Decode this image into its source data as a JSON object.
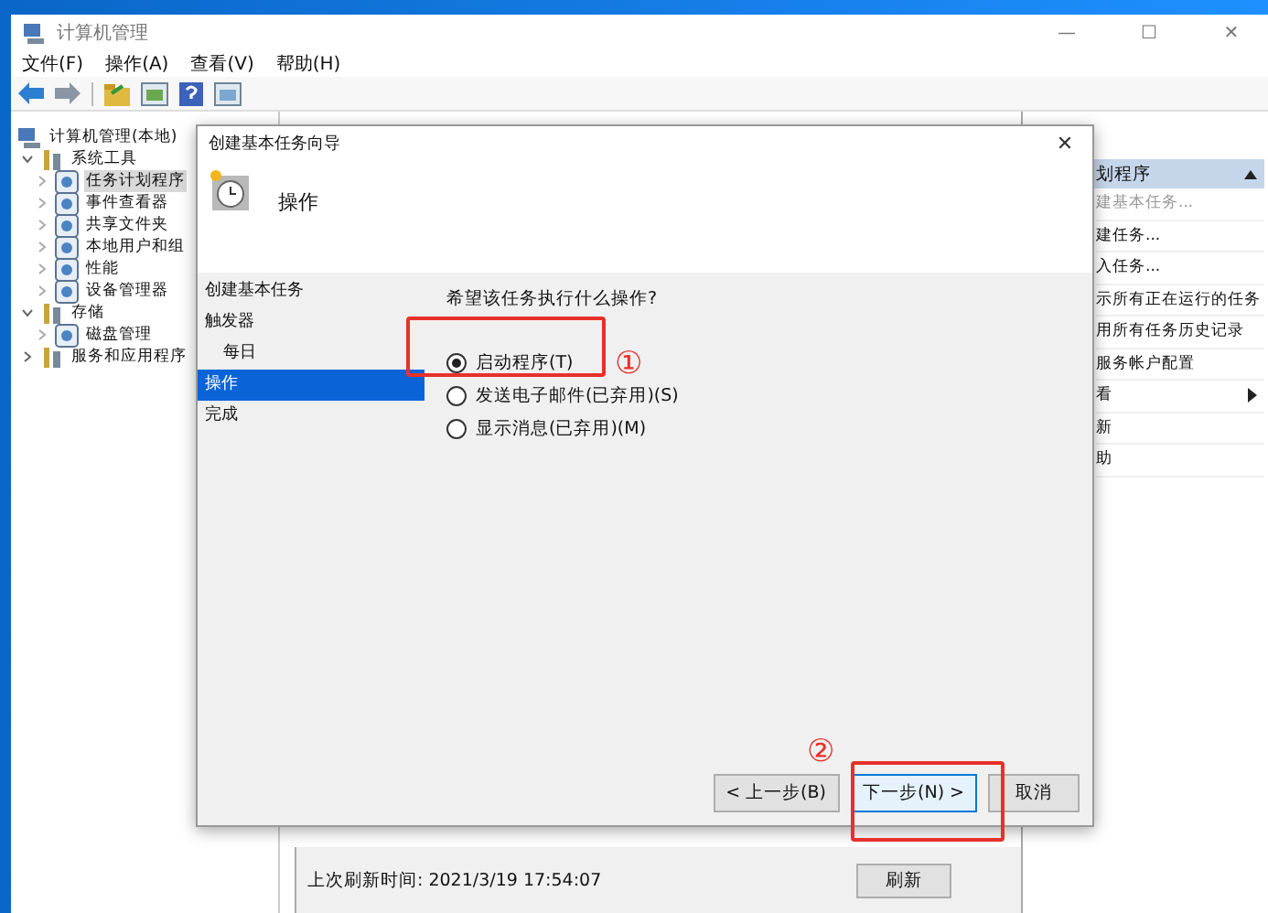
{
  "window": {
    "title": "计算机管理",
    "controls": [
      "—",
      "☐",
      "✕"
    ]
  },
  "menu": [
    "文件(F)",
    "操作(A)",
    "查看(V)",
    "帮助(H)"
  ],
  "tree": [
    {
      "label": "计算机管理(本地)",
      "selected": false,
      "children": [
        {
          "label": "系统工具",
          "expanded": true,
          "selected": false,
          "children": [
            {
              "label": "任务计划程序",
              "selected": true
            },
            {
              "label": "事件查看器",
              "selected": false
            },
            {
              "label": "共享文件夹",
              "selected": false
            },
            {
              "label": "本地用户和组",
              "selected": false
            },
            {
              "label": "性能",
              "selected": false
            },
            {
              "label": "设备管理器",
              "selected": false
            }
          ]
        },
        {
          "label": "存储",
          "expanded": true,
          "selected": false,
          "children": [
            {
              "label": "磁盘管理",
              "selected": false
            }
          ]
        },
        {
          "label": "服务和应用程序",
          "expanded": false,
          "selected": false
        }
      ]
    }
  ],
  "center": {
    "last_refresh": "上次刷新时间: 2021/3/19 17:54:07",
    "refresh_button": "刷新"
  },
  "actions": {
    "header": "划程序",
    "items": [
      {
        "label": "建基本任务...",
        "disabled": true,
        "submenu": false
      },
      {
        "label": "建任务...",
        "disabled": false,
        "submenu": false
      },
      {
        "label": "入任务...",
        "disabled": false,
        "submenu": false
      },
      {
        "label": "示所有正在运行的任务",
        "disabled": false,
        "submenu": false
      },
      {
        "label": "用所有任务历史记录",
        "disabled": false,
        "submenu": false
      },
      {
        "label": "服务帐户配置",
        "disabled": false,
        "submenu": false
      },
      {
        "label": "看",
        "disabled": false,
        "submenu": true
      },
      {
        "label": "新",
        "disabled": false,
        "submenu": false
      },
      {
        "label": "助",
        "disabled": false,
        "submenu": false
      }
    ]
  },
  "dialog": {
    "title": "创建基本任务向导",
    "close": "✕",
    "heading": "操作",
    "steps": [
      {
        "label": "创建基本任务",
        "selected": false,
        "indent": false
      },
      {
        "label": "触发器",
        "selected": false,
        "indent": false
      },
      {
        "label": "每日",
        "selected": false,
        "indent": true
      },
      {
        "label": "操作",
        "selected": true,
        "indent": false
      },
      {
        "label": "完成",
        "selected": false,
        "indent": false
      }
    ],
    "question": "希望该任务执行什么操作?",
    "options": [
      {
        "label": "启动程序(T)",
        "selected": true
      },
      {
        "label": "发送电子邮件(已弃用)(S)",
        "selected": false
      },
      {
        "label": "显示消息(已弃用)(M)",
        "selected": false
      }
    ],
    "buttons": [
      {
        "label": "< 上一步(B)",
        "focused": false
      },
      {
        "label": "下一步(N) >",
        "focused": true
      },
      {
        "label": "取消",
        "focused": false
      }
    ]
  },
  "annotations": [
    "①",
    "②"
  ]
}
